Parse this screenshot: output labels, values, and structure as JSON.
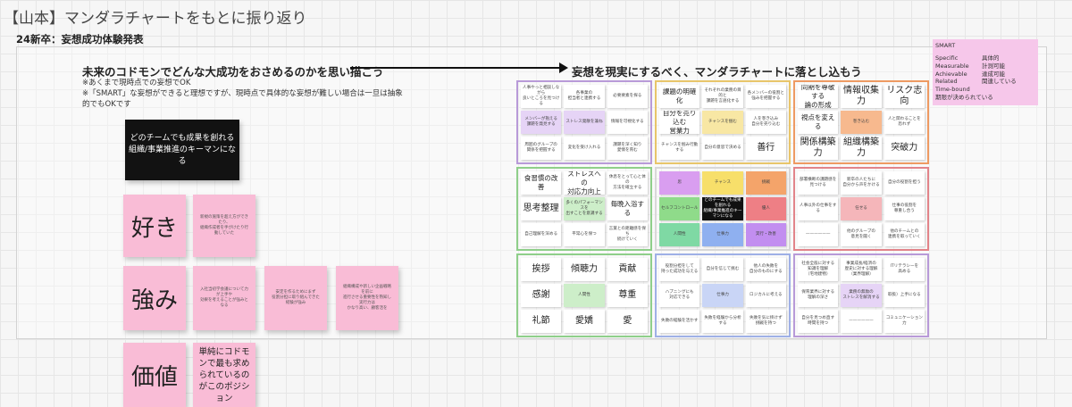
{
  "board": {
    "title": "【山本】マンダラチャートをもとに振り返り",
    "frame_label": "24新卒：妄想成功体験発表"
  },
  "headings": {
    "left": "未来のコドモンでどんな大成功をおさめるのかを思い描こう",
    "right": "妄想を現実にするべく、マンダラチャートに落とし込もう",
    "note_1": "※あくまで現時点での妄想でOK",
    "note_2": "※「SMART」な妄想ができると理想ですが、現時点で具体的な妄想が難しい場合は一旦は抽象",
    "note_3": "的でもOKです"
  },
  "black_sticky": {
    "text": "どのチームでも成果を創れる\n組織/事業推進のキーマンになる"
  },
  "rows": [
    {
      "label": "好き",
      "notes": [
        "新規の施策を超え方ができたり、\n組織作成者を手がけたり行動していた"
      ]
    },
    {
      "label": "強み",
      "notes": [
        "入社当初学会議について力が上手や\n効果を考えることが強みとなる",
        "安定を作るためにまず\n役割分担に取り組んできた経験が強み",
        "組織構成や新しい企画戦略を前に\n進行させる重要性を熟知し実行力は\nかなり高い、顧客活を"
      ]
    },
    {
      "label": "価値",
      "notes": [
        "単純にコドモンで最も求められているのがこのポジション"
      ]
    }
  ],
  "smart": {
    "title": "SMART",
    "items": [
      {
        "term": "Specific",
        "meaning": "具体的"
      },
      {
        "term": "Measurable",
        "meaning": "計測可能"
      },
      {
        "term": "Achievable",
        "meaning": "達成可能"
      },
      {
        "term": "Related",
        "meaning": "関連している"
      },
      {
        "term": "Time-bound",
        "meaning": ""
      },
      {
        "term": "期限が決められている",
        "meaning": ""
      }
    ]
  },
  "colors": {
    "sticky_pink": "#f9bcd6",
    "smart_bg": "#f6c7ea",
    "border_purple": "#b89ad8",
    "border_yellow": "#e8c56a",
    "border_orange": "#ee9a62",
    "border_green": "#8fcf8a",
    "border_red": "#e2848a",
    "border_blue": "#9fb0e6"
  },
  "mandala": {
    "blocks": [
      {
        "border": "#b89ad8",
        "cells": [
          {
            "t": "人事やっと相談しながら\n良いところを見つける",
            "s": "s",
            "bg": "#fff"
          },
          {
            "t": "各事業の\n担当者と連携する",
            "s": "s",
            "bg": "#fff"
          },
          {
            "t": "必要要素を探る",
            "s": "s",
            "bg": "#fff"
          },
          {
            "t": "メンバーが抱える\n課題を発見する",
            "s": "s",
            "bg": "#e6d4f6"
          },
          {
            "t": "ストレス発散を兼ね",
            "s": "s",
            "bg": "#e6d4f6"
          },
          {
            "t": "情報を可視化する",
            "s": "s",
            "bg": "#fff"
          },
          {
            "t": "周囲のグループの\n関係を把握する",
            "s": "s",
            "bg": "#fff"
          },
          {
            "t": "変化を受け入れる",
            "s": "s",
            "bg": "#fff"
          },
          {
            "t": "課題を深く知り\n愛情を育む",
            "s": "s",
            "bg": "#fff"
          }
        ]
      },
      {
        "border": "#e8c56a",
        "cells": [
          {
            "t": "課題の明確化",
            "s": "m",
            "bg": "#fff"
          },
          {
            "t": "それぞれの業務の目的と\n課題を言語化する",
            "s": "s",
            "bg": "#fff"
          },
          {
            "t": "各メンバーの役割と\n強みを把握する",
            "s": "s",
            "bg": "#fff"
          },
          {
            "t": "自分を売り込む\n営業力",
            "s": "m",
            "bg": "#fff"
          },
          {
            "t": "チャンスを掴む",
            "s": "s",
            "bg": "#f8e7a4"
          },
          {
            "t": "人を巻き込み\n自分を売り込む",
            "s": "s",
            "bg": "#fff"
          },
          {
            "t": "チャンスを掴み行動する",
            "s": "s",
            "bg": "#fff"
          },
          {
            "t": "自分の意思で決める",
            "s": "s",
            "bg": "#fff"
          },
          {
            "t": "善行",
            "s": "b",
            "bg": "#fff"
          }
        ]
      },
      {
        "border": "#ee9a62",
        "cells": [
          {
            "t": "同期を尊敬する\n論の形成",
            "s": "m",
            "bg": "#fff"
          },
          {
            "t": "情報収集力",
            "s": "b",
            "bg": "#fff"
          },
          {
            "t": "リスク志向",
            "s": "b",
            "bg": "#fff"
          },
          {
            "t": "視点を変える",
            "s": "m",
            "bg": "#fff"
          },
          {
            "t": "巻き込む",
            "s": "s",
            "bg": "#f7b98e"
          },
          {
            "t": "人と関わることを\n恐れず",
            "s": "s",
            "bg": "#fff"
          },
          {
            "t": "関係構築力",
            "s": "b",
            "bg": "#fff"
          },
          {
            "t": "組織構築力",
            "s": "b",
            "bg": "#fff"
          },
          {
            "t": "突破力",
            "s": "b",
            "bg": "#fff"
          }
        ]
      },
      {
        "border": "#8fcf8a",
        "cells": [
          {
            "t": "食習慣の改善",
            "s": "m",
            "bg": "#fff"
          },
          {
            "t": "ストレスへの\n対応力向上",
            "s": "m",
            "bg": "#fff"
          },
          {
            "t": "休息をとって心と体の\n方法を確立する",
            "s": "s",
            "bg": "#fff"
          },
          {
            "t": "思考整理",
            "s": "b",
            "bg": "#fff"
          },
          {
            "t": "多くのパフォーマンスを\n出すことを意識する",
            "s": "s",
            "bg": "#cdeec9"
          },
          {
            "t": "毎晩入浴する",
            "s": "m",
            "bg": "#fff"
          },
          {
            "t": "自己理解を深める",
            "s": "s",
            "bg": "#fff"
          },
          {
            "t": "平常心を保つ",
            "s": "s",
            "bg": "#fff"
          },
          {
            "t": "言葉との距離感を保ち\n続けていく",
            "s": "s",
            "bg": "#fff"
          }
        ]
      },
      {
        "border": "#d8d8d8",
        "cells": [
          {
            "t": "思",
            "s": "s",
            "bg": "#d99ef0"
          },
          {
            "t": "チャンス",
            "s": "s",
            "bg": "#f7df6a"
          },
          {
            "t": "挑戦",
            "s": "s",
            "bg": "#f4a46a"
          },
          {
            "t": "セルフコントロール",
            "s": "s",
            "bg": "#8fdb8a"
          },
          {
            "t": "どのチームでも成果を創れる\n組織/事業推進のキーマンになる",
            "s": "s",
            "bg": "#111"
          },
          {
            "t": "優人",
            "s": "s",
            "bg": "#ee7f85"
          },
          {
            "t": "人間性",
            "s": "s",
            "bg": "#7fd9a4"
          },
          {
            "t": "仕事力",
            "s": "s",
            "bg": "#8fb0f0"
          },
          {
            "t": "実行・改善",
            "s": "s",
            "bg": "#c28ef0"
          }
        ]
      },
      {
        "border": "#e2848a",
        "cells": [
          {
            "t": "部署横断の課題感を\n見つける",
            "s": "s",
            "bg": "#fff"
          },
          {
            "t": "新卒の人たちに\n自分から声をかける",
            "s": "s",
            "bg": "#fff"
          },
          {
            "t": "自分の役割を担う",
            "s": "s",
            "bg": "#fff"
          },
          {
            "t": "人事以外の仕事をする",
            "s": "s",
            "bg": "#fff"
          },
          {
            "t": "任せる",
            "s": "s",
            "bg": "#f5b6ba"
          },
          {
            "t": "仕事の役割を\n尊重し合う",
            "s": "s",
            "bg": "#fff"
          },
          {
            "t": "——————",
            "s": "s",
            "bg": "#fff"
          },
          {
            "t": "他のグループの\n意見を聞く",
            "s": "s",
            "bg": "#fff"
          },
          {
            "t": "他のチームとの\n連携を取っていく",
            "s": "s",
            "bg": "#fff"
          }
        ]
      },
      {
        "border": "#8fcf8a",
        "cells": [
          {
            "t": "挨拶",
            "s": "b",
            "bg": "#fff"
          },
          {
            "t": "傾聴力",
            "s": "b",
            "bg": "#fff"
          },
          {
            "t": "貢献",
            "s": "b",
            "bg": "#fff"
          },
          {
            "t": "感謝",
            "s": "b",
            "bg": "#fff"
          },
          {
            "t": "人間性",
            "s": "s",
            "bg": "#cdeec9"
          },
          {
            "t": "尊重",
            "s": "b",
            "bg": "#fff"
          },
          {
            "t": "礼節",
            "s": "b",
            "bg": "#fff"
          },
          {
            "t": "愛嬌",
            "s": "b",
            "bg": "#fff"
          },
          {
            "t": "愛",
            "s": "b",
            "bg": "#fff"
          }
        ]
      },
      {
        "border": "#9fb0e6",
        "cells": [
          {
            "t": "役割分担をして\n持った成功を与える",
            "s": "s",
            "bg": "#fff"
          },
          {
            "t": "自分を信じて挑む",
            "s": "s",
            "bg": "#fff"
          },
          {
            "t": "他人の失敗を\n自分のものにする",
            "s": "s",
            "bg": "#fff"
          },
          {
            "t": "ハプニングにも\n対応できる",
            "s": "s",
            "bg": "#fff"
          },
          {
            "t": "仕事力",
            "s": "s",
            "bg": "#c9d5f6"
          },
          {
            "t": "ロジカルに考える",
            "s": "s",
            "bg": "#fff"
          },
          {
            "t": "失敗の経験を活かす",
            "s": "s",
            "bg": "#fff"
          },
          {
            "t": "失敗を経験から分析する",
            "s": "s",
            "bg": "#fff"
          },
          {
            "t": "失敗を気に掛けず\n挑戦を持つ",
            "s": "s",
            "bg": "#fff"
          }
        ]
      },
      {
        "border": "#b89ad8",
        "cells": [
          {
            "t": "社会全般に対する\n知識を理解\n（宅地建物）",
            "s": "s",
            "bg": "#fff"
          },
          {
            "t": "事業成長/経済の\n歴史に対する理解\n（業界理解）",
            "s": "s",
            "bg": "#fff"
          },
          {
            "t": "ITリテラシーを\n高める",
            "s": "s",
            "bg": "#fff"
          },
          {
            "t": "保育業界に対する\n理解の深さ",
            "s": "s",
            "bg": "#fff"
          },
          {
            "t": "業務の無駄の\nストレスを解消する",
            "s": "s",
            "bg": "#e6d4f6"
          },
          {
            "t": "取扱）上手になる",
            "s": "s",
            "bg": "#fff"
          },
          {
            "t": "自分を見つめ直す\n時間を持つ",
            "s": "s",
            "bg": "#fff"
          },
          {
            "t": "——————",
            "s": "s",
            "bg": "#fff"
          },
          {
            "t": "コミュニケーション力",
            "s": "s",
            "bg": "#fff"
          }
        ]
      }
    ]
  }
}
